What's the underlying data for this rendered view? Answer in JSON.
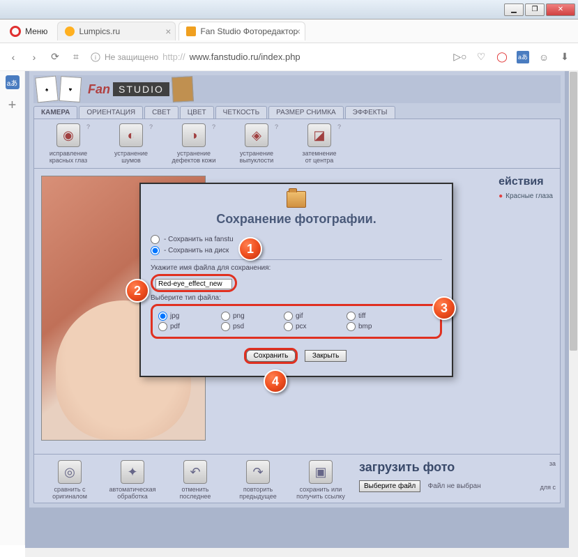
{
  "win_controls": {
    "min": "▁",
    "max": "❐",
    "close": "✕"
  },
  "browser": {
    "menu": "Меню",
    "tabs": [
      {
        "title": "Lumpics.ru"
      },
      {
        "title": "Fan Studio Фоторедактор"
      }
    ],
    "nav": {
      "back": "‹",
      "fwd": "›",
      "reload": "⟳",
      "speed": "⌗"
    },
    "security": "Не защищено",
    "url_prefix": "http://",
    "url": "www.fanstudio.ru/index.php"
  },
  "sidebar": {
    "trans": "aあ",
    "plus": "+"
  },
  "fanstudio": {
    "logo_script": "Fan",
    "logo_studio": "STUDIO",
    "tabs": [
      "КАМЕРА",
      "ОРИЕНТАЦИЯ",
      "СВЕТ",
      "ЦВЕТ",
      "ЧЕТКОСТЬ",
      "РАЗМЕР СНИМКА",
      "ЭФФЕКТЫ"
    ],
    "tools": [
      {
        "g": "◉",
        "l1": "исправление",
        "l2": "красных глаз"
      },
      {
        "g": "◐",
        "l1": "устранение",
        "l2": "шумов"
      },
      {
        "g": "◑",
        "l1": "устранение",
        "l2": "дефектов кожи"
      },
      {
        "g": "◈",
        "l1": "устранение",
        "l2": "выпуклости"
      },
      {
        "g": "◪",
        "l1": "затемнение",
        "l2": "от центра"
      }
    ],
    "actions_heading": "ействия",
    "actions_item": "Красные глаза",
    "bottom_tools": [
      {
        "g": "◎",
        "l1": "сравнить с",
        "l2": "оригиналом"
      },
      {
        "g": "✦",
        "l1": "автоматическая",
        "l2": "обработка"
      },
      {
        "g": "↶",
        "l1": "отменить",
        "l2": "последнее"
      },
      {
        "g": "↷",
        "l1": "повторить",
        "l2": "предыдущее"
      },
      {
        "g": "▣",
        "l1": "сохранить или",
        "l2": "получить ссылку"
      }
    ],
    "upload": {
      "title": "загрузить фото",
      "button": "Выберите файл",
      "status": "Файл не выбран",
      "extra1": "за",
      "extra2": "для с"
    }
  },
  "dialog": {
    "title": "Сохранение фотографии.",
    "opt1": "- Сохранить на fanstu",
    "opt2": "- Сохранить на диск",
    "filename_label": "Укажите имя файла для сохранения:",
    "filename": "Red-eye_effect_new",
    "filetype_label": "Выберите тип файла:",
    "types_row1": [
      "jpg",
      "png",
      "gif",
      "tiff"
    ],
    "types_row2": [
      "pdf",
      "psd",
      "pcx",
      "bmp"
    ],
    "save": "Сохранить",
    "close": "Закрыть"
  },
  "balloons": {
    "b1": "1",
    "b2": "2",
    "b3": "3",
    "b4": "4"
  }
}
